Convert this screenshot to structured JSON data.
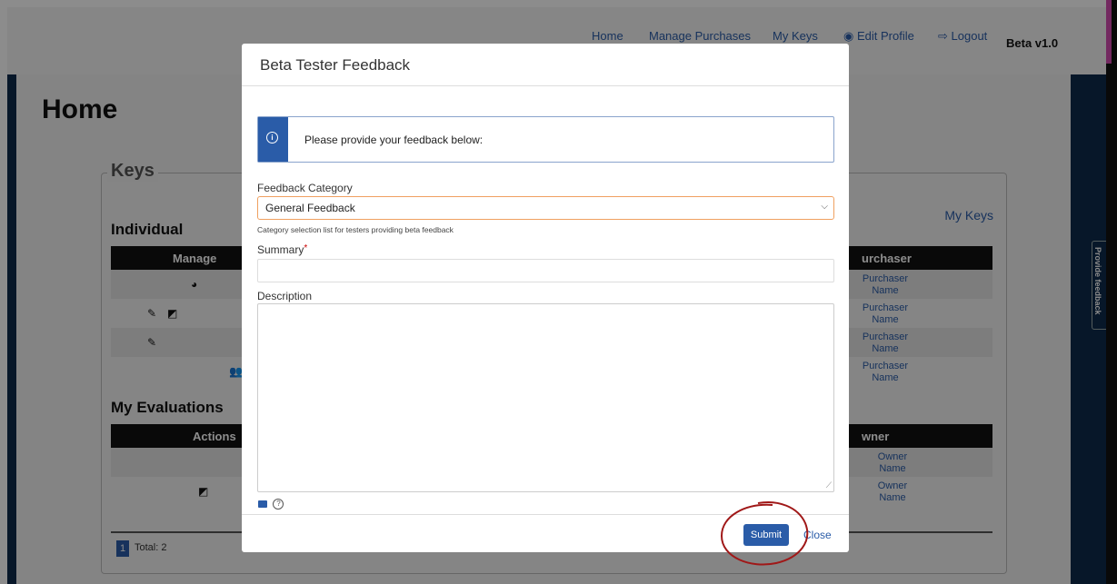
{
  "nav": {
    "home": "Home",
    "manage_purchases": "Manage Purchases",
    "my_keys": "My Keys",
    "edit_profile": "Edit Profile",
    "logout": "Logout",
    "version": "Beta v1.0"
  },
  "page": {
    "title": "Home",
    "keys_legend": "Keys",
    "individual_title": "Individual",
    "my_keys_link": "My Keys",
    "individual_headers": {
      "manage": "Manage",
      "purchaser": "urchaser"
    },
    "purchaser_rows": [
      {
        "line1": "Purchaser",
        "line2": "Name"
      },
      {
        "line1": "Purchaser",
        "line2": "Name"
      },
      {
        "line1": "Purchaser",
        "line2": "Name"
      },
      {
        "line1": "Purchaser",
        "line2": "Name"
      }
    ],
    "evaluations_title": "My Evaluations",
    "eval_headers": {
      "actions": "Actions",
      "owner": "wner"
    },
    "owner_rows": [
      {
        "line1": "Owner",
        "line2": "Name"
      },
      {
        "line1": "Owner",
        "line2": "Name"
      }
    ],
    "pager": {
      "page": "1",
      "total": "Total: 2"
    }
  },
  "side_tab": {
    "label": "Provide feedback"
  },
  "modal": {
    "title": "Beta Tester Feedback",
    "info_text": "Please provide your feedback below:",
    "category_label": "Feedback Category",
    "category_value": "General Feedback",
    "category_help": "Category selection list for testers providing beta feedback",
    "summary_label": "Summary",
    "summary_required": "*",
    "description_label": "Description",
    "submit_label": "Submit",
    "close_label": "Close"
  }
}
